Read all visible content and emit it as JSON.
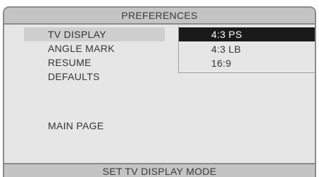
{
  "title": "PREFERENCES",
  "menu": {
    "items": [
      {
        "label": "TV DISPLAY"
      },
      {
        "label": "ANGLE MARK"
      },
      {
        "label": "RESUME"
      },
      {
        "label": "DEFAULTS"
      }
    ],
    "main_page": "MAIN PAGE",
    "highlighted": "TV DISPLAY"
  },
  "submenu": {
    "options": [
      {
        "label": "4:3 PS"
      },
      {
        "label": "4:3 LB"
      },
      {
        "label": "16:9"
      }
    ],
    "selected": "4:3 PS"
  },
  "status": "SET TV DISPLAY MODE",
  "colors": {
    "background": "#e6e6e6",
    "bar": "#c4c4c4",
    "selected_bg": "#1a1a1a",
    "selected_text": "#ffffff"
  }
}
